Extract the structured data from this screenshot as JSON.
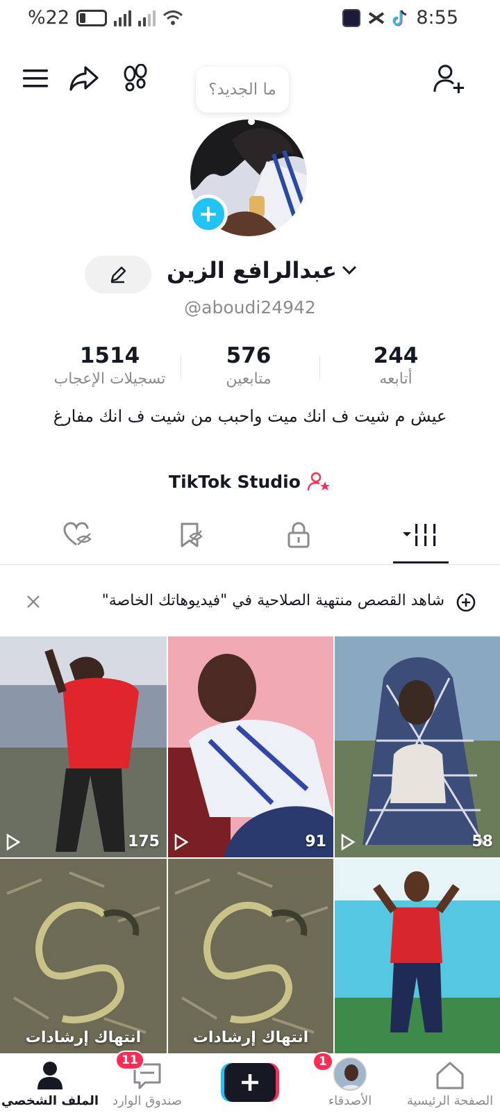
{
  "status_bar": {
    "battery": "%22",
    "time": "8:55"
  },
  "header": {
    "bubble_text": "ما الجديد؟"
  },
  "profile": {
    "name": "عبدالرافع الزين",
    "handle": "@aboudi24942",
    "stats": [
      {
        "label": "أتابعه",
        "value": "244"
      },
      {
        "label": "متابعين",
        "value": "576"
      },
      {
        "label": "تسجيلات الإعجاب",
        "value": "1514"
      }
    ],
    "bio": "عيش م شيت ف انك ميت واحبب من شيت ف انك مفارغ",
    "studio_label": "TikTok Studio"
  },
  "banner": {
    "text": "شاهد القصص منتهية الصلاحية في \"فيديوهاتك الخاصة\""
  },
  "grid": [
    {
      "views": "58"
    },
    {
      "views": "91"
    },
    {
      "views": "175"
    },
    {
      "caption": "انتهاك إرشادات"
    },
    {
      "caption": "انتهاك إرشادات"
    }
  ],
  "nav": {
    "home": "الصفحة الرئيسية",
    "friends": "الأصدقاء",
    "friends_badge": "1",
    "inbox": "صندوق الوارد",
    "inbox_badge": "11",
    "profile": "الملف الشخصي"
  },
  "colors": {
    "accent": "#fe2c55",
    "cyan": "#20c4f4"
  }
}
